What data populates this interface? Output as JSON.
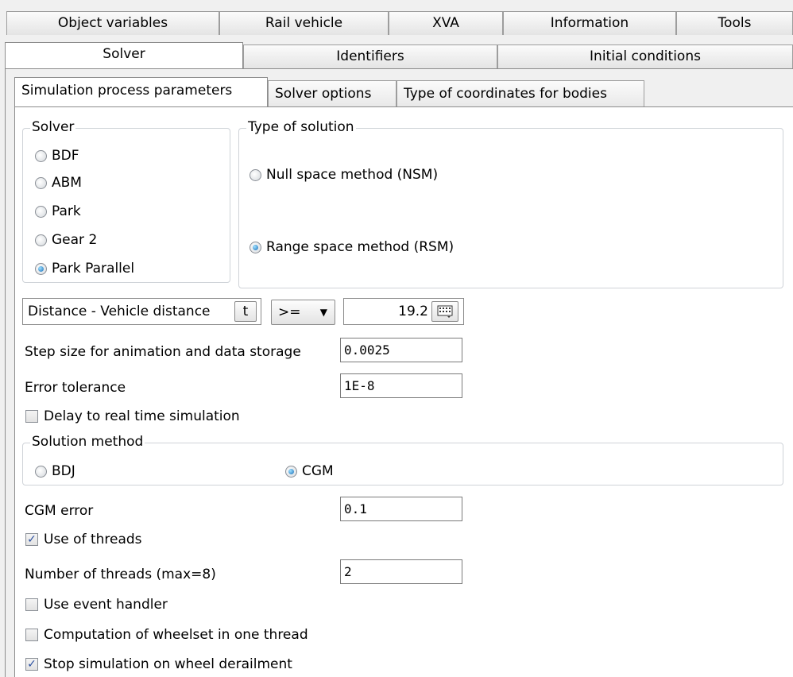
{
  "top_tabs_row1": [
    "Object variables",
    "Rail vehicle",
    "XVA",
    "Information",
    "Tools"
  ],
  "top_tabs_row2": [
    "Solver",
    "Identifiers",
    "Initial conditions"
  ],
  "sub_tabs": [
    "Simulation process parameters",
    "Solver options",
    "Type of coordinates for bodies"
  ],
  "solver_group": {
    "legend": "Solver",
    "options": [
      "BDF",
      "ABM",
      "Park",
      "Gear 2",
      "Park Parallel"
    ],
    "selected": "Park Parallel"
  },
  "solution_type_group": {
    "legend": "Type of solution",
    "options": [
      "Null space method (NSM)",
      "Range space method (RSM)"
    ],
    "selected": "Range space method (RSM)"
  },
  "end_condition": {
    "variable": "Distance - Vehicle distance",
    "var_button": "t",
    "operator": ">=",
    "value": "19.2"
  },
  "step_size": {
    "label": "Step size for animation and data storage",
    "value": "0.0025"
  },
  "error_tolerance": {
    "label": "Error tolerance",
    "value": "1E-8"
  },
  "delay_realtime": {
    "label": "Delay to real time simulation",
    "checked": false
  },
  "solution_method": {
    "legend": "Solution method",
    "options": [
      "BDJ",
      "CGM"
    ],
    "selected": "CGM"
  },
  "cgm_error": {
    "label": "CGM error",
    "value": "0.1"
  },
  "use_threads": {
    "label": "Use of threads",
    "checked": true
  },
  "num_threads": {
    "label": "Number of threads (max=8)",
    "value": "2"
  },
  "use_event_handler": {
    "label": "Use event handler",
    "checked": false
  },
  "wheelset_one_thread": {
    "label": "Computation of wheelset in one thread",
    "checked": false
  },
  "stop_on_derailment": {
    "label": "Stop simulation on wheel derailment",
    "checked": true
  },
  "colors": {
    "radio_selected": "#1a6fb8",
    "check_mark": "#2a4fa0",
    "panel_bg": "#ffffff",
    "window_bg": "#f0f0f0"
  }
}
